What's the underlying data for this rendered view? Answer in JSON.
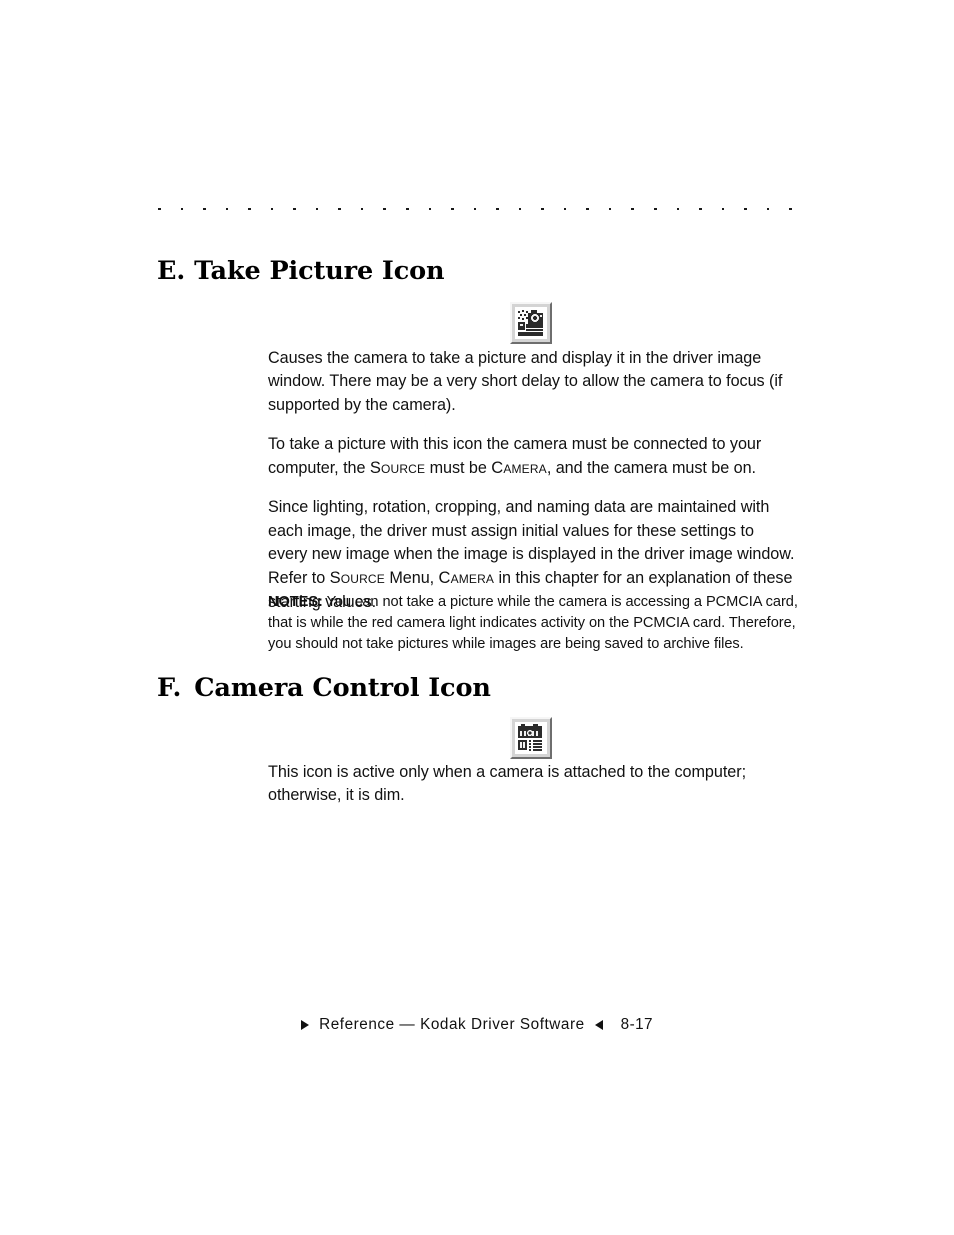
{
  "document": {
    "divider": {
      "name": "dotted-rule",
      "dot_count": 29
    },
    "sections": [
      {
        "id": "E",
        "letter": "E.",
        "title": "Take Picture Icon",
        "icon": {
          "name": "take-picture-icon",
          "alt": "camera taking a picture"
        }
      },
      {
        "id": "F",
        "letter": "F.",
        "title": "Camera Control Icon",
        "icon": {
          "name": "camera-control-icon",
          "alt": "camera with control list panel"
        }
      }
    ],
    "paragraphs": {
      "p1": "Causes the camera to take a picture and display it in the driver image window. There may be a very short delay to allow the camera to focus (if supported by the camera).",
      "p2_part1": "To take a picture with this icon the camera must be connected to your computer, the ",
      "p2_sc1": "Source",
      "p2_part2": " must be ",
      "p2_sc2": "Camera",
      "p2_part3": ", and the camera must be on.",
      "p3_part1": "Since lighting, rotation, cropping, and naming data are maintained with each image, the driver must assign initial values for these settings to every new image when the image is displayed in the driver image window. Refer to ",
      "p3_sc1": "Source",
      "p3_part2": " Menu, ",
      "p3_sc2": "Camera",
      "p3_part3": " in this chapter for an explanation of these starting values.",
      "notes_label": "NOTES:",
      "notes_text": " You can not take a picture while the camera is accessing a PCMCIA card, that is while the red camera light indicates activity on the PCMCIA card. Therefore, you should not take pictures while images are being saved to archive files.",
      "p5": "This icon is active only when a camera is attached to the computer; otherwise, it is dim."
    },
    "footer": {
      "marker_left": "▶",
      "text": "Reference — Kodak Driver Software",
      "marker_right": "◀",
      "page": "8-17"
    },
    "colors": {
      "text": "#111111",
      "background": "#ffffff",
      "icon_face": "#d4d4d4",
      "icon_highlight": "#f6f6f6",
      "icon_shadow": "#6e6e6e"
    }
  }
}
